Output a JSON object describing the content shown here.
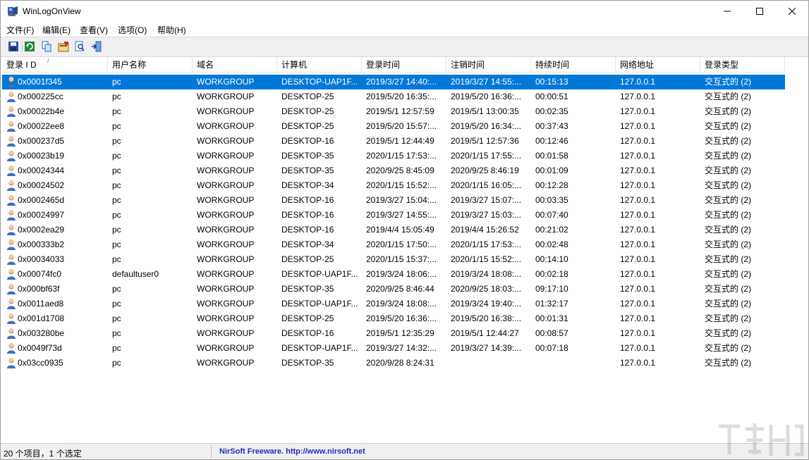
{
  "window": {
    "title": "WinLogOnView"
  },
  "menu": [
    {
      "label": "文件(F)"
    },
    {
      "label": "编辑(E)"
    },
    {
      "label": "查看(V)"
    },
    {
      "label": "选项(O)"
    },
    {
      "label": "帮助(H)"
    }
  ],
  "toolbar": {
    "icons": [
      "save-icon",
      "refresh-icon",
      "copy-icon",
      "properties-icon",
      "find-icon",
      "exit-icon"
    ]
  },
  "columns": [
    {
      "label": "登录 I D"
    },
    {
      "label": "用户名称"
    },
    {
      "label": "域名"
    },
    {
      "label": "计算机"
    },
    {
      "label": "登录时间"
    },
    {
      "label": "注销时间"
    },
    {
      "label": "持续时间"
    },
    {
      "label": "网络地址"
    },
    {
      "label": "登录类型"
    }
  ],
  "sort": {
    "column": "登录 I D",
    "indicator": "/"
  },
  "rows": [
    [
      "0x0001f345",
      "pc",
      "WORKGROUP",
      "DESKTOP-UAP1F...",
      "2019/3/27 14:40:...",
      "2019/3/27 14:55:...",
      "00:15:13",
      "127.0.0.1",
      "交互式的 (2)"
    ],
    [
      "0x000225cc",
      "pc",
      "WORKGROUP",
      "DESKTOP-25",
      "2019/5/20 16:35:...",
      "2019/5/20 16:36:...",
      "00:00:51",
      "127.0.0.1",
      "交互式的 (2)"
    ],
    [
      "0x00022b4e",
      "pc",
      "WORKGROUP",
      "DESKTOP-25",
      "2019/5/1 12:57:59",
      "2019/5/1 13:00:35",
      "00:02:35",
      "127.0.0.1",
      "交互式的 (2)"
    ],
    [
      "0x00022ee8",
      "pc",
      "WORKGROUP",
      "DESKTOP-25",
      "2019/5/20 15:57:...",
      "2019/5/20 16:34:...",
      "00:37:43",
      "127.0.0.1",
      "交互式的 (2)"
    ],
    [
      "0x000237d5",
      "pc",
      "WORKGROUP",
      "DESKTOP-16",
      "2019/5/1 12:44:49",
      "2019/5/1 12:57:36",
      "00:12:46",
      "127.0.0.1",
      "交互式的 (2)"
    ],
    [
      "0x00023b19",
      "pc",
      "WORKGROUP",
      "DESKTOP-35",
      "2020/1/15 17:53:...",
      "2020/1/15 17:55:...",
      "00:01:58",
      "127.0.0.1",
      "交互式的 (2)"
    ],
    [
      "0x00024344",
      "pc",
      "WORKGROUP",
      "DESKTOP-35",
      "2020/9/25 8:45:09",
      "2020/9/25 8:46:19",
      "00:01:09",
      "127.0.0.1",
      "交互式的 (2)"
    ],
    [
      "0x00024502",
      "pc",
      "WORKGROUP",
      "DESKTOP-34",
      "2020/1/15 15:52:...",
      "2020/1/15 16:05:...",
      "00:12:28",
      "127.0.0.1",
      "交互式的 (2)"
    ],
    [
      "0x0002465d",
      "pc",
      "WORKGROUP",
      "DESKTOP-16",
      "2019/3/27 15:04:...",
      "2019/3/27 15:07:...",
      "00:03:35",
      "127.0.0.1",
      "交互式的 (2)"
    ],
    [
      "0x00024997",
      "pc",
      "WORKGROUP",
      "DESKTOP-16",
      "2019/3/27 14:55:...",
      "2019/3/27 15:03:...",
      "00:07:40",
      "127.0.0.1",
      "交互式的 (2)"
    ],
    [
      "0x0002ea29",
      "pc",
      "WORKGROUP",
      "DESKTOP-16",
      "2019/4/4 15:05:49",
      "2019/4/4 15:26:52",
      "00:21:02",
      "127.0.0.1",
      "交互式的 (2)"
    ],
    [
      "0x000333b2",
      "pc",
      "WORKGROUP",
      "DESKTOP-34",
      "2020/1/15 17:50:...",
      "2020/1/15 17:53:...",
      "00:02:48",
      "127.0.0.1",
      "交互式的 (2)"
    ],
    [
      "0x00034033",
      "pc",
      "WORKGROUP",
      "DESKTOP-25",
      "2020/1/15 15:37:...",
      "2020/1/15 15:52:...",
      "00:14:10",
      "127.0.0.1",
      "交互式的 (2)"
    ],
    [
      "0x00074fc0",
      "defaultuser0",
      "WORKGROUP",
      "DESKTOP-UAP1F...",
      "2019/3/24 18:06:...",
      "2019/3/24 18:08:...",
      "00:02:18",
      "127.0.0.1",
      "交互式的 (2)"
    ],
    [
      "0x000bf63f",
      "pc",
      "WORKGROUP",
      "DESKTOP-35",
      "2020/9/25 8:46:44",
      "2020/9/25 18:03:...",
      "09:17:10",
      "127.0.0.1",
      "交互式的 (2)"
    ],
    [
      "0x0011aed8",
      "pc",
      "WORKGROUP",
      "DESKTOP-UAP1F...",
      "2019/3/24 18:08:...",
      "2019/3/24 19:40:...",
      "01:32:17",
      "127.0.0.1",
      "交互式的 (2)"
    ],
    [
      "0x001d1708",
      "pc",
      "WORKGROUP",
      "DESKTOP-25",
      "2019/5/20 16:36:...",
      "2019/5/20 16:38:...",
      "00:01:31",
      "127.0.0.1",
      "交互式的 (2)"
    ],
    [
      "0x003280be",
      "pc",
      "WORKGROUP",
      "DESKTOP-16",
      "2019/5/1 12:35:29",
      "2019/5/1 12:44:27",
      "00:08:57",
      "127.0.0.1",
      "交互式的 (2)"
    ],
    [
      "0x0049f73d",
      "pc",
      "WORKGROUP",
      "DESKTOP-UAP1F...",
      "2019/3/27 14:32:...",
      "2019/3/27 14:39:...",
      "00:07:18",
      "127.0.0.1",
      "交互式的 (2)"
    ],
    [
      "0x03cc0935",
      "pc",
      "WORKGROUP",
      "DESKTOP-35",
      "2020/9/28 8:24:31",
      "",
      "",
      "127.0.0.1",
      "交互式的 (2)"
    ]
  ],
  "selected_row": 0,
  "status": {
    "summary": "20 个项目，1 个选定",
    "link": "NirSoft Freeware.  http://www.nirsoft.net"
  },
  "colors": {
    "selection": "#0078d7",
    "link": "#1a2dbf"
  }
}
